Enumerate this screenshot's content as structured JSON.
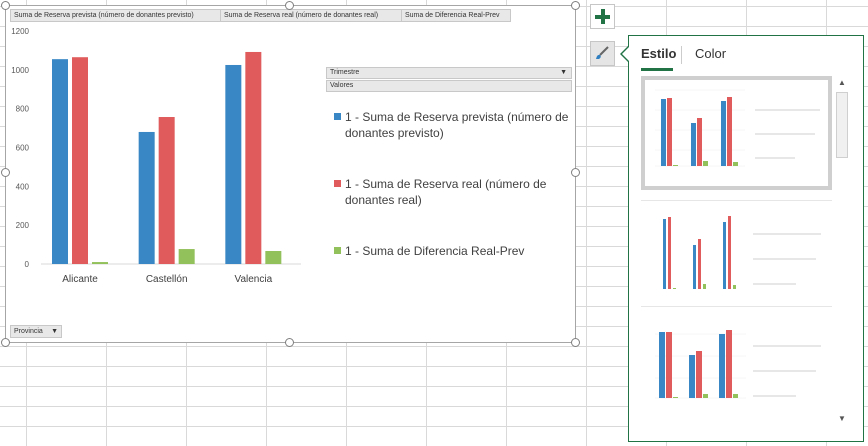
{
  "chart": {
    "field_buttons": {
      "series1": "Suma de Reserva prevista (número de donantes previsto)",
      "series2": "Suma de Reserva real (número de donantes real)",
      "series3": "Suma de Diferencia Real-Prev"
    },
    "trimestre_label": "Trimestre",
    "valores_label": "Valores",
    "provincia_label": "Provincia",
    "legend": [
      {
        "text": "1 - Suma de Reserva prevista (número de donantes previsto)",
        "color": "#3a87c5"
      },
      {
        "text": "1 - Suma de Reserva real (número de donantes real)",
        "color": "#e05b5b"
      },
      {
        "text": "1 - Suma de Diferencia Real-Prev",
        "color": "#92c05a"
      }
    ]
  },
  "chart_data": {
    "type": "bar",
    "categories": [
      "Alicante",
      "Castellón",
      "Valencia"
    ],
    "yticks": [
      "0",
      "200",
      "400",
      "600",
      "800",
      "1000",
      "1200"
    ],
    "ylim": [
      0,
      1200
    ],
    "series": [
      {
        "name": "1 - Suma de Reserva prevista (número de donantes previsto)",
        "color": "#3a87c5",
        "values": [
          1055,
          680,
          1025
        ]
      },
      {
        "name": "1 - Suma de Reserva real (número de donantes real)",
        "color": "#e05b5b",
        "values": [
          1065,
          757,
          1092
        ]
      },
      {
        "name": "1 - Suma de Diferencia Real-Prev",
        "color": "#92c05a",
        "values": [
          10,
          77,
          67
        ]
      }
    ]
  },
  "pane": {
    "tabs": [
      "Estilo",
      "Color"
    ],
    "active_tab": "Estilo",
    "accent": "#217346"
  },
  "side_buttons": {
    "add_icon": "plus-icon",
    "style_icon": "brush-icon"
  }
}
